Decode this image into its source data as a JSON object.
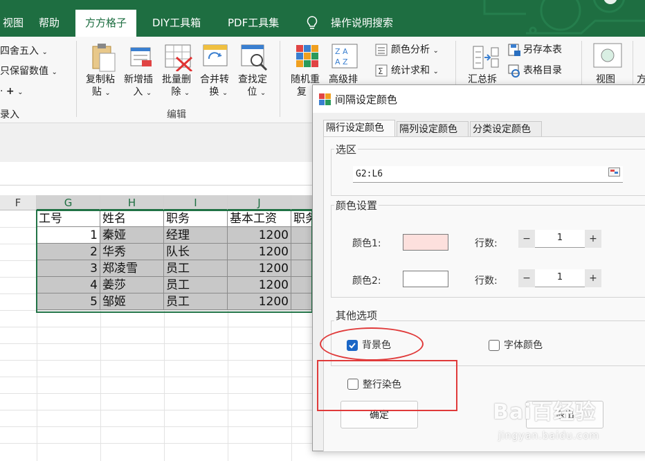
{
  "ribbon_tabs": [
    {
      "label": "视图"
    },
    {
      "label": "帮助"
    },
    {
      "label": "方方格子"
    },
    {
      "label": "DIY工具箱"
    },
    {
      "label": "PDF工具集"
    },
    {
      "label": "操作说明搜索"
    }
  ],
  "ribbon": {
    "round_label": "四舍五入",
    "keep_value_label": "只保留数值",
    "plus_label": "+",
    "record_label": "录入",
    "copy_paste_label": [
      "复制粘",
      "贴"
    ],
    "add_insert_label": [
      "新增插",
      "入"
    ],
    "batch_delete_label": [
      "批量删",
      "除"
    ],
    "merge_convert_label": [
      "合并转",
      "换"
    ],
    "find_locate_label": [
      "查找定",
      "位"
    ],
    "edit_group_label": "编辑",
    "random_repeat_label": [
      "随机重",
      "复"
    ],
    "advanced_sort_label": "高级排",
    "color_analysis_label": "颜色分析",
    "stats_sum_label": "统计求和",
    "summary_split_label": "汇总拆",
    "save_as_label": "另存本表",
    "table_catalog_label": "表格目录",
    "view_label": "视图",
    "more_label": "方"
  },
  "sheet": {
    "columns": [
      "F",
      "G",
      "H",
      "I",
      "J"
    ],
    "headers": [
      "工号",
      "姓名",
      "职务",
      "基本工资",
      "职务"
    ],
    "rows": [
      {
        "id": "1",
        "name": "秦娅",
        "title": "经理",
        "salary": "1200"
      },
      {
        "id": "2",
        "name": "华秀",
        "title": "队长",
        "salary": "1200"
      },
      {
        "id": "3",
        "name": "郑凌雪",
        "title": "员工",
        "salary": "1200"
      },
      {
        "id": "4",
        "name": "姜莎",
        "title": "员工",
        "salary": "1200"
      },
      {
        "id": "5",
        "name": "邹姬",
        "title": "员工",
        "salary": "1200"
      }
    ]
  },
  "dialog": {
    "title": "间隔设定颜色",
    "tabs": [
      {
        "label": "隔行设定颜色"
      },
      {
        "label": "隔列设定颜色"
      },
      {
        "label": "分类设定颜色"
      }
    ],
    "selection_group": "选区",
    "range_value": "G2:L6",
    "color_group": "颜色设置",
    "color1_label": "颜色1:",
    "color2_label": "颜色2:",
    "rows_label": "行数:",
    "color1_value": "#fde0dd",
    "color2_value": "#ffffff",
    "rows1": "1",
    "rows2": "1",
    "minus": "−",
    "plus": "+",
    "other_group": "其他选项",
    "bg_color_label": "背景色",
    "font_color_label": "字体颜色",
    "whole_row_label": "整行染色",
    "ok_label": "确定",
    "exit_label": "退出"
  },
  "watermark": {
    "brand": "Bai百经验",
    "url": "jingyan.baidu.com"
  },
  "colors": {
    "ribbon_green": "#1e6e41",
    "selection_green": "#217346",
    "annotation_red": "#e03a3a",
    "checkbox_blue": "#1a66c6"
  }
}
